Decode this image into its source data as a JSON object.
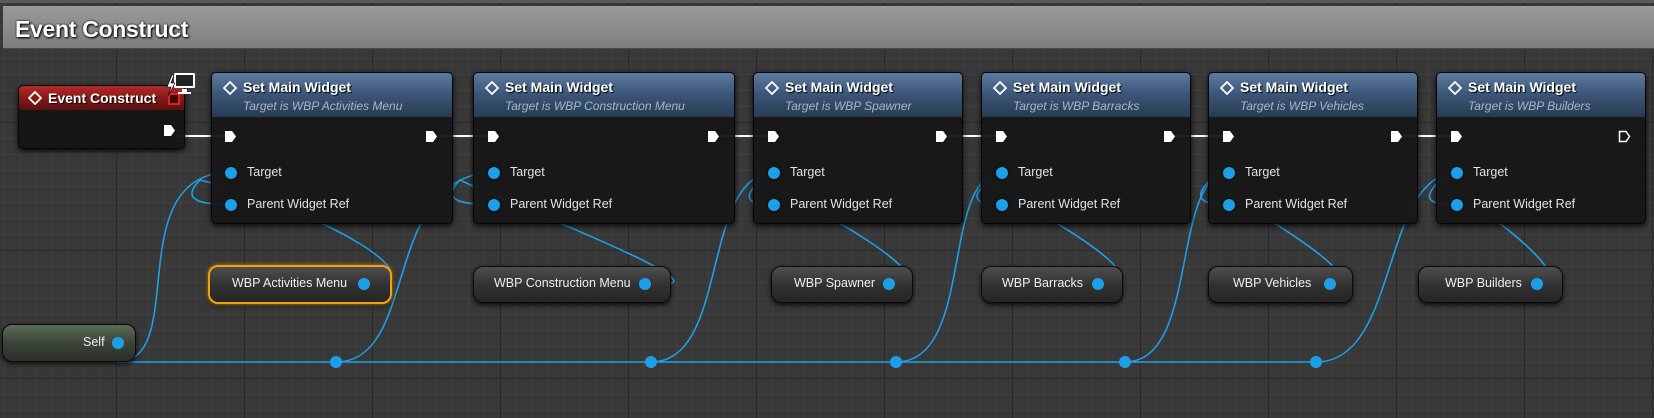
{
  "comment": {
    "title": "Event Construct"
  },
  "event_node": {
    "title": "Event Construct",
    "icon": "event-icon"
  },
  "function_nodes": [
    {
      "title": "Set Main Widget",
      "subtitle": "Target is WBP Activities Menu",
      "pin_target": "Target",
      "pin_parent": "Parent Widget Ref"
    },
    {
      "title": "Set Main Widget",
      "subtitle": "Target is WBP Construction Menu",
      "pin_target": "Target",
      "pin_parent": "Parent Widget Ref"
    },
    {
      "title": "Set Main Widget",
      "subtitle": "Target is WBP Spawner",
      "pin_target": "Target",
      "pin_parent": "Parent Widget Ref"
    },
    {
      "title": "Set Main Widget",
      "subtitle": "Target is WBP Barracks",
      "pin_target": "Target",
      "pin_parent": "Parent Widget Ref"
    },
    {
      "title": "Set Main Widget",
      "subtitle": "Target is WBP Vehicles",
      "pin_target": "Target",
      "pin_parent": "Parent Widget Ref"
    },
    {
      "title": "Set Main Widget",
      "subtitle": "Target is WBP Builders",
      "pin_target": "Target",
      "pin_parent": "Parent Widget Ref"
    }
  ],
  "variable_nodes": [
    {
      "label": "WBP Activities Menu",
      "selected": true
    },
    {
      "label": "WBP Construction Menu",
      "selected": false
    },
    {
      "label": "WBP Spawner",
      "selected": false
    },
    {
      "label": "WBP Barracks",
      "selected": false
    },
    {
      "label": "WBP Vehicles",
      "selected": false
    },
    {
      "label": "WBP Builders",
      "selected": false
    }
  ],
  "self_node": {
    "label": "Self"
  },
  "colors": {
    "object_wire": "#1d9fe8",
    "exec_wire": "#ffffff",
    "selection": "#f0a017",
    "event_header": "#9b2020",
    "function_header": "#3d5879"
  }
}
